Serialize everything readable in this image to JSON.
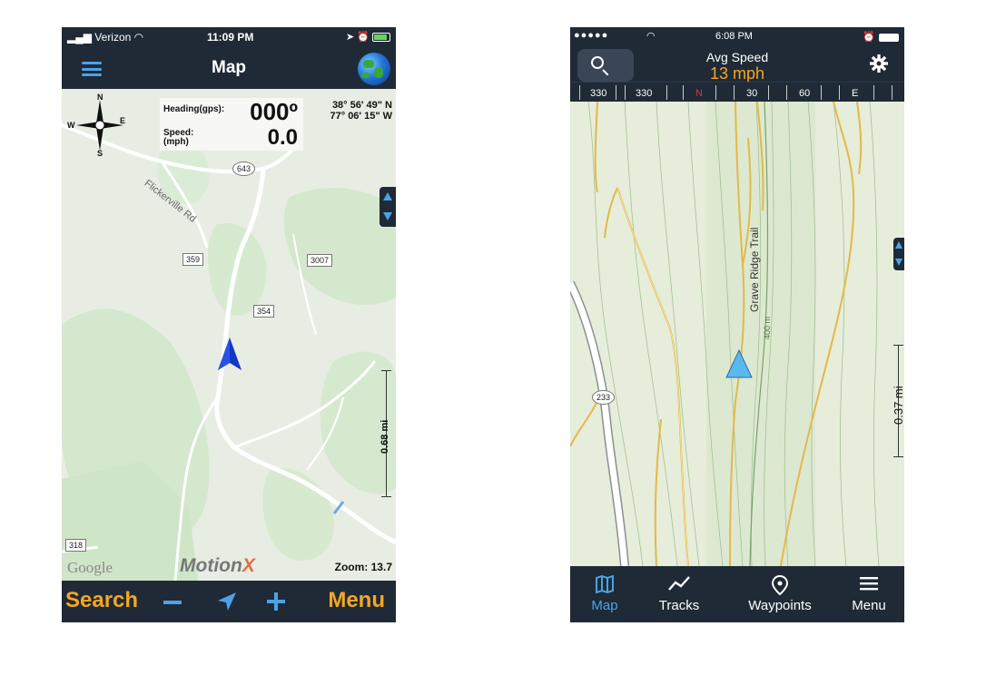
{
  "left_app": {
    "status_bar": {
      "carrier": "Verizon",
      "time": "11:09 PM"
    },
    "top_bar": {
      "title": "Map",
      "menu_icon": "hamburger-icon",
      "globe_icon": "globe-icon"
    },
    "compass": {
      "n": "N",
      "s": "S",
      "e": "E",
      "w": "W"
    },
    "info": {
      "heading_label": "Heading(gps):",
      "heading_value": "000º",
      "speed_label_1": "Speed:",
      "speed_label_2": "(mph)",
      "speed_value": "0.0",
      "latitude": "38° 56' 49\" N",
      "longitude": "77° 06' 15\" W"
    },
    "map_labels": {
      "road_name": "Flickerville Rd",
      "shield_643": "643",
      "shield_359": "359",
      "shield_3007": "3007",
      "shield_354": "354",
      "shield_318": "318"
    },
    "scale": "0.68 mi",
    "google": "Google",
    "brand_motion": "Motion",
    "brand_x": "X",
    "zoom": "Zoom: 13.7",
    "bottom_bar": {
      "search": "Search",
      "menu": "Menu"
    },
    "colors": {
      "bar": "#1f2a36",
      "accent_orange": "#f5a623",
      "accent_blue": "#4aa3e8",
      "position_arrow": "#1437c8"
    }
  },
  "right_app": {
    "status_bar": {
      "time": "6:08 PM"
    },
    "top_bar": {
      "avg_speed_label": "Avg Speed",
      "avg_speed_value": "13 mph"
    },
    "heading_strip": [
      "330",
      "330",
      "N",
      "30",
      "60",
      "E"
    ],
    "map_labels": {
      "trail": "Grave Ridge Trail",
      "elevation": "400 m",
      "road_shield": "233"
    },
    "scale": "0.37 mi",
    "tabs": [
      {
        "label": "Map",
        "icon": "map-icon",
        "active": true
      },
      {
        "label": "Tracks",
        "icon": "tracks-icon",
        "active": false
      },
      {
        "label": "Waypoints",
        "icon": "waypoint-pin-icon",
        "active": false
      },
      {
        "label": "Menu",
        "icon": "menu-icon",
        "active": false
      }
    ],
    "colors": {
      "bar": "#1f2a36",
      "accent_orange": "#f5a623",
      "active_tab": "#4aa3e8",
      "position_arrow": "#5bb8ef",
      "trail": "#e9c44a"
    }
  }
}
